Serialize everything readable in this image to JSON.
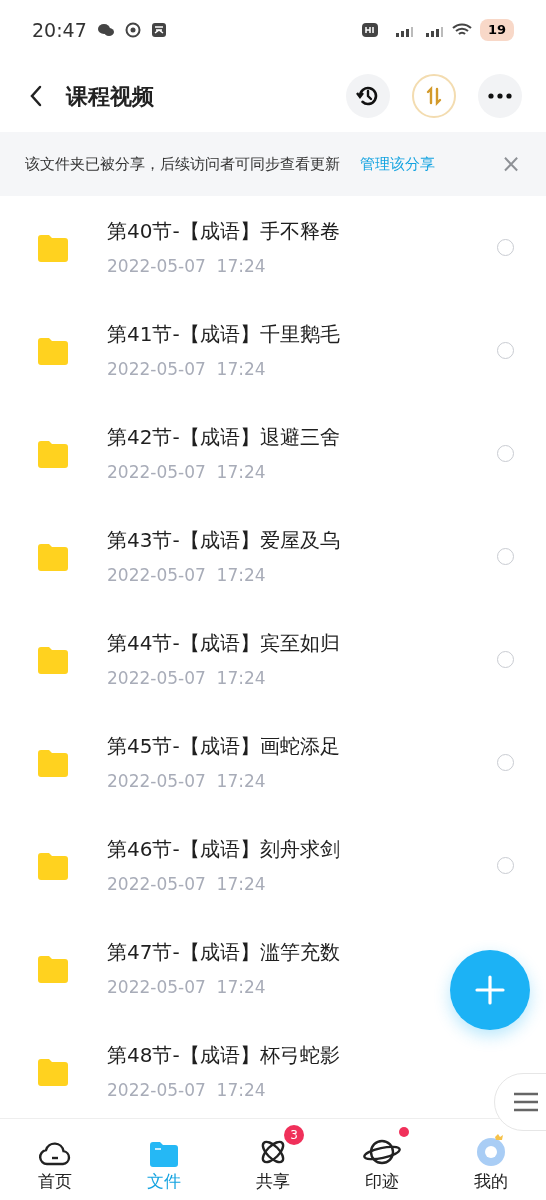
{
  "status_bar": {
    "time": "20:47",
    "battery": "19"
  },
  "header": {
    "title": "课程视频"
  },
  "banner": {
    "text": "该文件夹已被分享，后续访问者可同步查看更新",
    "link": "管理该分享",
    "close": "×"
  },
  "files": [
    {
      "name": "第40节-【成语】手不释卷",
      "date": "2022-05-07  17:24",
      "selected": false
    },
    {
      "name": "第41节-【成语】千里鹅毛",
      "date": "2022-05-07  17:24",
      "selected": false
    },
    {
      "name": "第42节-【成语】退避三舍",
      "date": "2022-05-07  17:24",
      "selected": false
    },
    {
      "name": "第43节-【成语】爱屋及乌",
      "date": "2022-05-07  17:24",
      "selected": false
    },
    {
      "name": "第44节-【成语】宾至如归",
      "date": "2022-05-07  17:24",
      "selected": false
    },
    {
      "name": "第45节-【成语】画蛇添足",
      "date": "2022-05-07  17:24",
      "selected": false
    },
    {
      "name": "第46节-【成语】刻舟求剑",
      "date": "2022-05-07  17:24",
      "selected": false
    },
    {
      "name": "第47节-【成语】滥竽充数",
      "date": "2022-05-07  17:24"
    },
    {
      "name": "第48节-【成语】杯弓蛇影",
      "date": "2022-05-07  17:24"
    }
  ],
  "nav": [
    {
      "kind": "home",
      "label": "首页",
      "selected": false
    },
    {
      "kind": "files",
      "label": "文件",
      "selected": true
    },
    {
      "kind": "share",
      "label": "共享",
      "selected": false,
      "badge": "3"
    },
    {
      "kind": "planet",
      "label": "印迹",
      "selected": false,
      "dot": true
    },
    {
      "kind": "me",
      "label": "我的",
      "selected": false
    }
  ]
}
